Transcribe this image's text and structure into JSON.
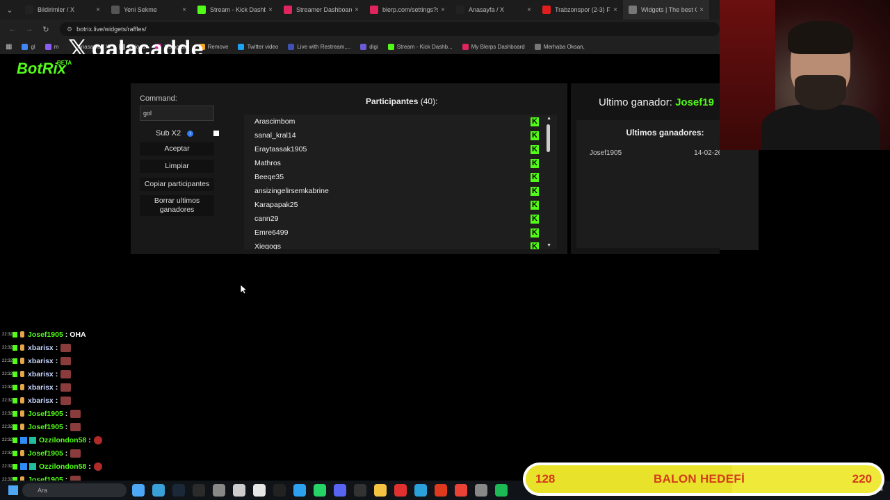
{
  "browser": {
    "tabs": [
      {
        "title": "Bildirimler / X",
        "icon": "x-icon",
        "color": "#222"
      },
      {
        "title": "Yeni Sekme",
        "icon": "chrome-icon",
        "color": "#555"
      },
      {
        "title": "Stream - Kick Dashbo",
        "icon": "kick-icon",
        "color": "#53fc18"
      },
      {
        "title": "Streamer Dashboard",
        "icon": "blerp-icon",
        "color": "#e0245e"
      },
      {
        "title": "blerp.com/settings?s",
        "icon": "blerp-icon",
        "color": "#e0245e"
      },
      {
        "title": "Anasayfa / X",
        "icon": "x-icon",
        "color": "#222"
      },
      {
        "title": "Trabzonspor (2-3) Fe",
        "icon": "youtube-icon",
        "color": "#e01e1e"
      },
      {
        "title": "Widgets | The best C",
        "icon": "botrix-icon",
        "color": "#777"
      }
    ],
    "url": "botrix.live/widgets/raffles/",
    "bookmarks": [
      {
        "label": "gl",
        "color": "#4285f4"
      },
      {
        "label": "m",
        "color": "#8a5cf6"
      },
      {
        "label": "Anasayfa / X",
        "color": "#222"
      },
      {
        "label": "Upload",
        "color": "#888"
      },
      {
        "label": "Instagram",
        "color": "#d6249f"
      },
      {
        "label": "Remove",
        "color": "#f5a623"
      },
      {
        "label": "Twitter video",
        "color": "#1da1f2"
      },
      {
        "label": "Live with Restream,...",
        "color": "#3f51b5"
      },
      {
        "label": "digi",
        "color": "#6b5bd6"
      },
      {
        "label": "Stream - Kick Dashb...",
        "color": "#53fc18"
      },
      {
        "label": "My Blerps Dashboard",
        "color": "#e0245e"
      },
      {
        "label": "Merhaba Oksan,",
        "color": "#777"
      }
    ]
  },
  "overlay": {
    "logo_text": "galacadde",
    "x_mark": "𝕏"
  },
  "brand": {
    "name": "BotRix",
    "badge": "BETA"
  },
  "raffle": {
    "command_label": "Command:",
    "command_value": "gol",
    "sub_label": "Sub X2",
    "info_glyph": "i",
    "buttons": {
      "accept": "Aceptar",
      "clear": "Limpiar",
      "copy": "Copiar participantes",
      "delete_winners": "Borrar ultimos ganadores"
    },
    "participants_title": "Participantes",
    "participants_count": "(40):",
    "participants": [
      "Arascimbom",
      "sanal_kral14",
      "Eraytassak1905",
      "Mathros",
      "Beeqe35",
      "ansizingelirsemkabrine",
      "Karapapak25",
      "cann29",
      "Emre6499",
      "Xiegogs"
    ],
    "last_winner_label": "Ultimo ganador:",
    "last_winner_name": "Josef19",
    "winners_title": "Ultimos ganadores:",
    "winners": [
      {
        "name": "Josef1905",
        "date": "14-02-26 22:32"
      }
    ]
  },
  "chat": [
    {
      "ts": "22:32",
      "user": "Josef1905",
      "color": "#53fc18",
      "badges": [
        "k",
        "s"
      ],
      "msg": "OHA",
      "emote": ""
    },
    {
      "ts": "22:32",
      "user": "xbarisx",
      "color": "#c8d6ff",
      "badges": [
        "k",
        "s"
      ],
      "msg": "",
      "emote": "cat"
    },
    {
      "ts": "22:32",
      "user": "xbarisx",
      "color": "#c8d6ff",
      "badges": [
        "k",
        "s"
      ],
      "msg": "",
      "emote": "cat"
    },
    {
      "ts": "22:32",
      "user": "xbarisx",
      "color": "#c8d6ff",
      "badges": [
        "k",
        "s"
      ],
      "msg": "",
      "emote": "cat"
    },
    {
      "ts": "22:32",
      "user": "xbarisx",
      "color": "#c8d6ff",
      "badges": [
        "k",
        "s"
      ],
      "msg": "",
      "emote": "cat"
    },
    {
      "ts": "22:32",
      "user": "xbarisx",
      "color": "#c8d6ff",
      "badges": [
        "k",
        "s"
      ],
      "msg": "",
      "emote": "cat"
    },
    {
      "ts": "22:32",
      "user": "Josef1905",
      "color": "#53fc18",
      "badges": [
        "k",
        "s"
      ],
      "msg": "",
      "emote": "cat"
    },
    {
      "ts": "22:32",
      "user": "Josef1905",
      "color": "#53fc18",
      "badges": [
        "k",
        "s"
      ],
      "msg": "",
      "emote": "cat"
    },
    {
      "ts": "22:32",
      "user": "Ozzilondon58",
      "color": "#53fc18",
      "badges": [
        "k",
        "b",
        "g"
      ],
      "msg": "",
      "emote": "devil"
    },
    {
      "ts": "22:32",
      "user": "Josef1905",
      "color": "#53fc18",
      "badges": [
        "k",
        "s"
      ],
      "msg": "",
      "emote": "cat"
    },
    {
      "ts": "22:32",
      "user": "Ozzilondon58",
      "color": "#53fc18",
      "badges": [
        "k",
        "b",
        "g"
      ],
      "msg": "",
      "emote": "devil"
    },
    {
      "ts": "22:32",
      "user": "Josef1905",
      "color": "#53fc18",
      "badges": [
        "k",
        "s"
      ],
      "msg": "",
      "emote": "cat"
    },
    {
      "ts": "22:32",
      "user": "Ozzilondon58",
      "color": "#53fc18",
      "badges": [
        "k",
        "b",
        "g"
      ],
      "msg": "",
      "emote": "devil"
    }
  ],
  "taskbar": {
    "search_placeholder": "Ara",
    "icon_colors": [
      "#4ea7f5",
      "#3aa0d8",
      "#1b2838",
      "#2b2b2b",
      "#888",
      "#cccccc",
      "#e6e6e6",
      "#222",
      "#2ea0f0",
      "#25d366",
      "#5865f2",
      "#333",
      "#f5c242",
      "#e03030",
      "#2aa1da",
      "#e03a1e",
      "#ea4335",
      "#888",
      "#1db954"
    ]
  },
  "goal": {
    "current": "128",
    "title": "BALON HEDEFİ",
    "max": "220",
    "progress": 0.58
  }
}
